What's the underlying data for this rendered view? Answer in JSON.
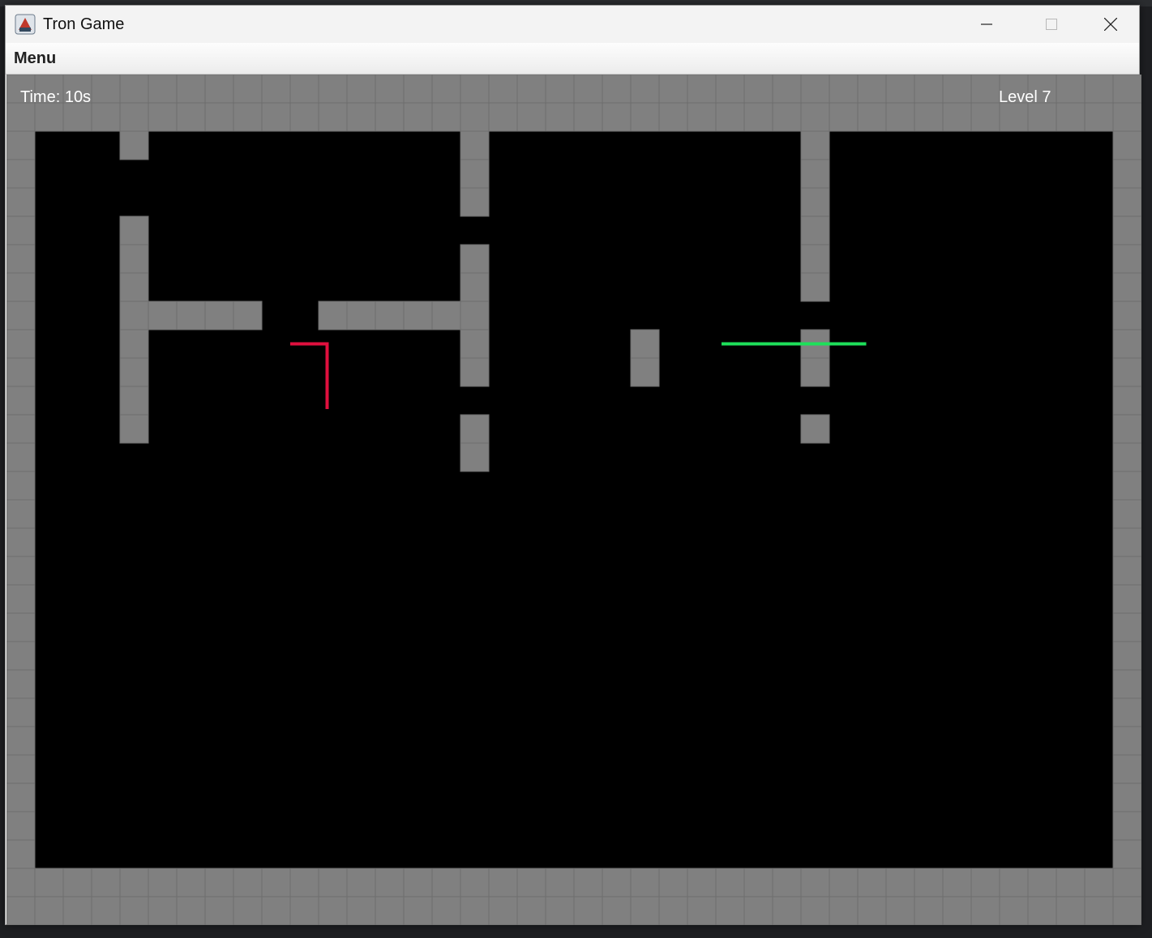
{
  "window": {
    "title": "Tron Game",
    "controls": [
      "minimize-icon",
      "maximize-icon",
      "close-icon"
    ]
  },
  "menubar": {
    "items": [
      {
        "label": "Menu"
      }
    ]
  },
  "hud": {
    "time": "Time: 10s",
    "level": "Level 7"
  },
  "colors": {
    "wall": "#808080",
    "wall_grid": "#6e6e6e",
    "floor": "#000000",
    "player_red": "#e0103e",
    "player_green": "#1ee05a"
  },
  "board": {
    "cols": 40,
    "rows": 30,
    "walls": [
      [
        4,
        2
      ],
      [
        16,
        2
      ],
      [
        16,
        3
      ],
      [
        16,
        4
      ],
      [
        28,
        2
      ],
      [
        28,
        3
      ],
      [
        28,
        4
      ],
      [
        28,
        5
      ],
      [
        28,
        6
      ],
      [
        28,
        7
      ],
      [
        4,
        5
      ],
      [
        4,
        6
      ],
      [
        4,
        7
      ],
      [
        16,
        6
      ],
      [
        16,
        7
      ],
      [
        4,
        8
      ],
      [
        5,
        8
      ],
      [
        6,
        8
      ],
      [
        7,
        8
      ],
      [
        8,
        8
      ],
      [
        11,
        8
      ],
      [
        12,
        8
      ],
      [
        13,
        8
      ],
      [
        14,
        8
      ],
      [
        15,
        8
      ],
      [
        16,
        8
      ],
      [
        4,
        9
      ],
      [
        4,
        10
      ],
      [
        4,
        11
      ],
      [
        4,
        12
      ],
      [
        16,
        9
      ],
      [
        16,
        10
      ],
      [
        22,
        9
      ],
      [
        22,
        10
      ],
      [
        28,
        9
      ],
      [
        28,
        10
      ],
      [
        16,
        12
      ],
      [
        16,
        13
      ],
      [
        28,
        12
      ]
    ]
  },
  "players": [
    {
      "name": "red",
      "color_key": "player_red",
      "path": [
        [
          10,
          9.5
        ],
        [
          11.3,
          9.5
        ],
        [
          11.3,
          11.8
        ]
      ]
    },
    {
      "name": "green",
      "color_key": "player_green",
      "path": [
        [
          25.2,
          9.5
        ],
        [
          30.3,
          9.5
        ]
      ]
    }
  ]
}
